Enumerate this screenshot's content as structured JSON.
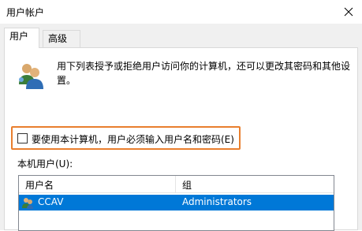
{
  "window": {
    "title": "用户帐户"
  },
  "tabs": [
    {
      "label": "用户",
      "active": true
    },
    {
      "label": "高级",
      "active": false
    }
  ],
  "panel": {
    "description": "用下列表授予或拒绝用户访问你的计算机，还可以更改其密码和其他设置。",
    "require_password_label": "要使用本计算机，用户必须输入用户名和密码(E)",
    "require_password_checked": false,
    "local_users_label": "本机用户(U):"
  },
  "users_table": {
    "columns": [
      "用户名",
      "组"
    ],
    "rows": [
      {
        "name": "CCAV",
        "group": "Administrators",
        "selected": true
      }
    ]
  },
  "colors": {
    "selection": "#0078d7",
    "highlight_border": "#e97f2e"
  }
}
